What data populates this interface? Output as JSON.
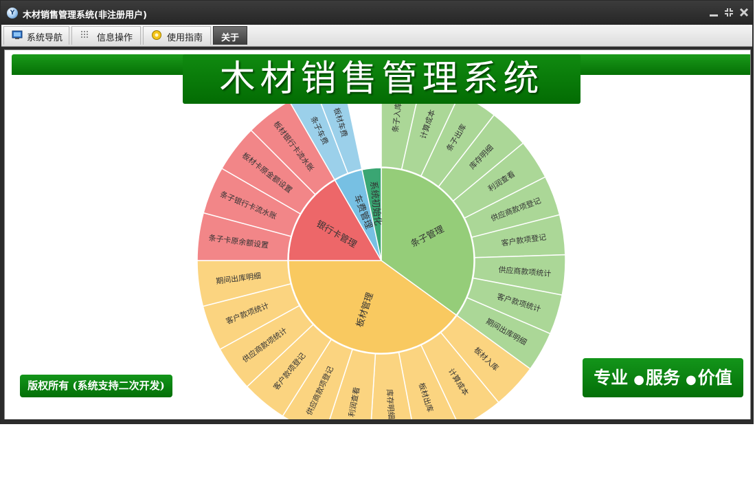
{
  "window": {
    "title": "木材销售管理系统(非注册用户)"
  },
  "menu": {
    "items": [
      {
        "label": "系统导航",
        "icon": "monitor-icon",
        "active": false
      },
      {
        "label": "信息操作",
        "icon": "grid-icon",
        "active": false
      },
      {
        "label": "使用指南",
        "icon": "help-icon",
        "active": false
      },
      {
        "label": "关于",
        "icon": "",
        "active": true
      }
    ]
  },
  "banner": {
    "title": "木材销售管理系统"
  },
  "footer": {
    "copyright": "版权所有 (系统支持二次开发)",
    "slogan": [
      "专业",
      "服务",
      "价值"
    ]
  },
  "colors": {
    "brand_green": "#0a7d0a",
    "tiao_zi": "#95cd79",
    "tiao_zi_light": "#abd797",
    "ban_cai": "#f9c960",
    "ban_cai_light": "#fbd480",
    "bank_card": "#ed6769",
    "bank_card_light": "#f28688",
    "freight": "#77c0e3",
    "freight_light": "#9bd0ea",
    "sys_init": "#3aa673"
  },
  "chart_data": {
    "type": "sunburst",
    "sectors": [
      {
        "name": "条子管理",
        "children": [
          "条子入库",
          "计算成本",
          "条子出库",
          "库存明细",
          "利润查看",
          "供应商款项登记",
          "客户款项登记",
          "供应商款项统计",
          "客户款项统计",
          "期间出库明细"
        ]
      },
      {
        "name": "板材管理",
        "children": [
          "板材入库",
          "计算成本",
          "板材出库",
          "库存明细",
          "利润查看",
          "供应商款项登记",
          "客户款项登记",
          "供应商款项统计",
          "客户款项统计",
          "期间出库明细"
        ]
      },
      {
        "name": "银行卡管理",
        "children": [
          "条子卡原余额设置",
          "条子银行卡流水账",
          "板材卡原金额设置",
          "板材银行卡流水账"
        ]
      },
      {
        "name": "车费管理",
        "children": [
          "条子车费",
          "板材车费"
        ]
      },
      {
        "name": "系统初始化",
        "children": []
      }
    ]
  }
}
